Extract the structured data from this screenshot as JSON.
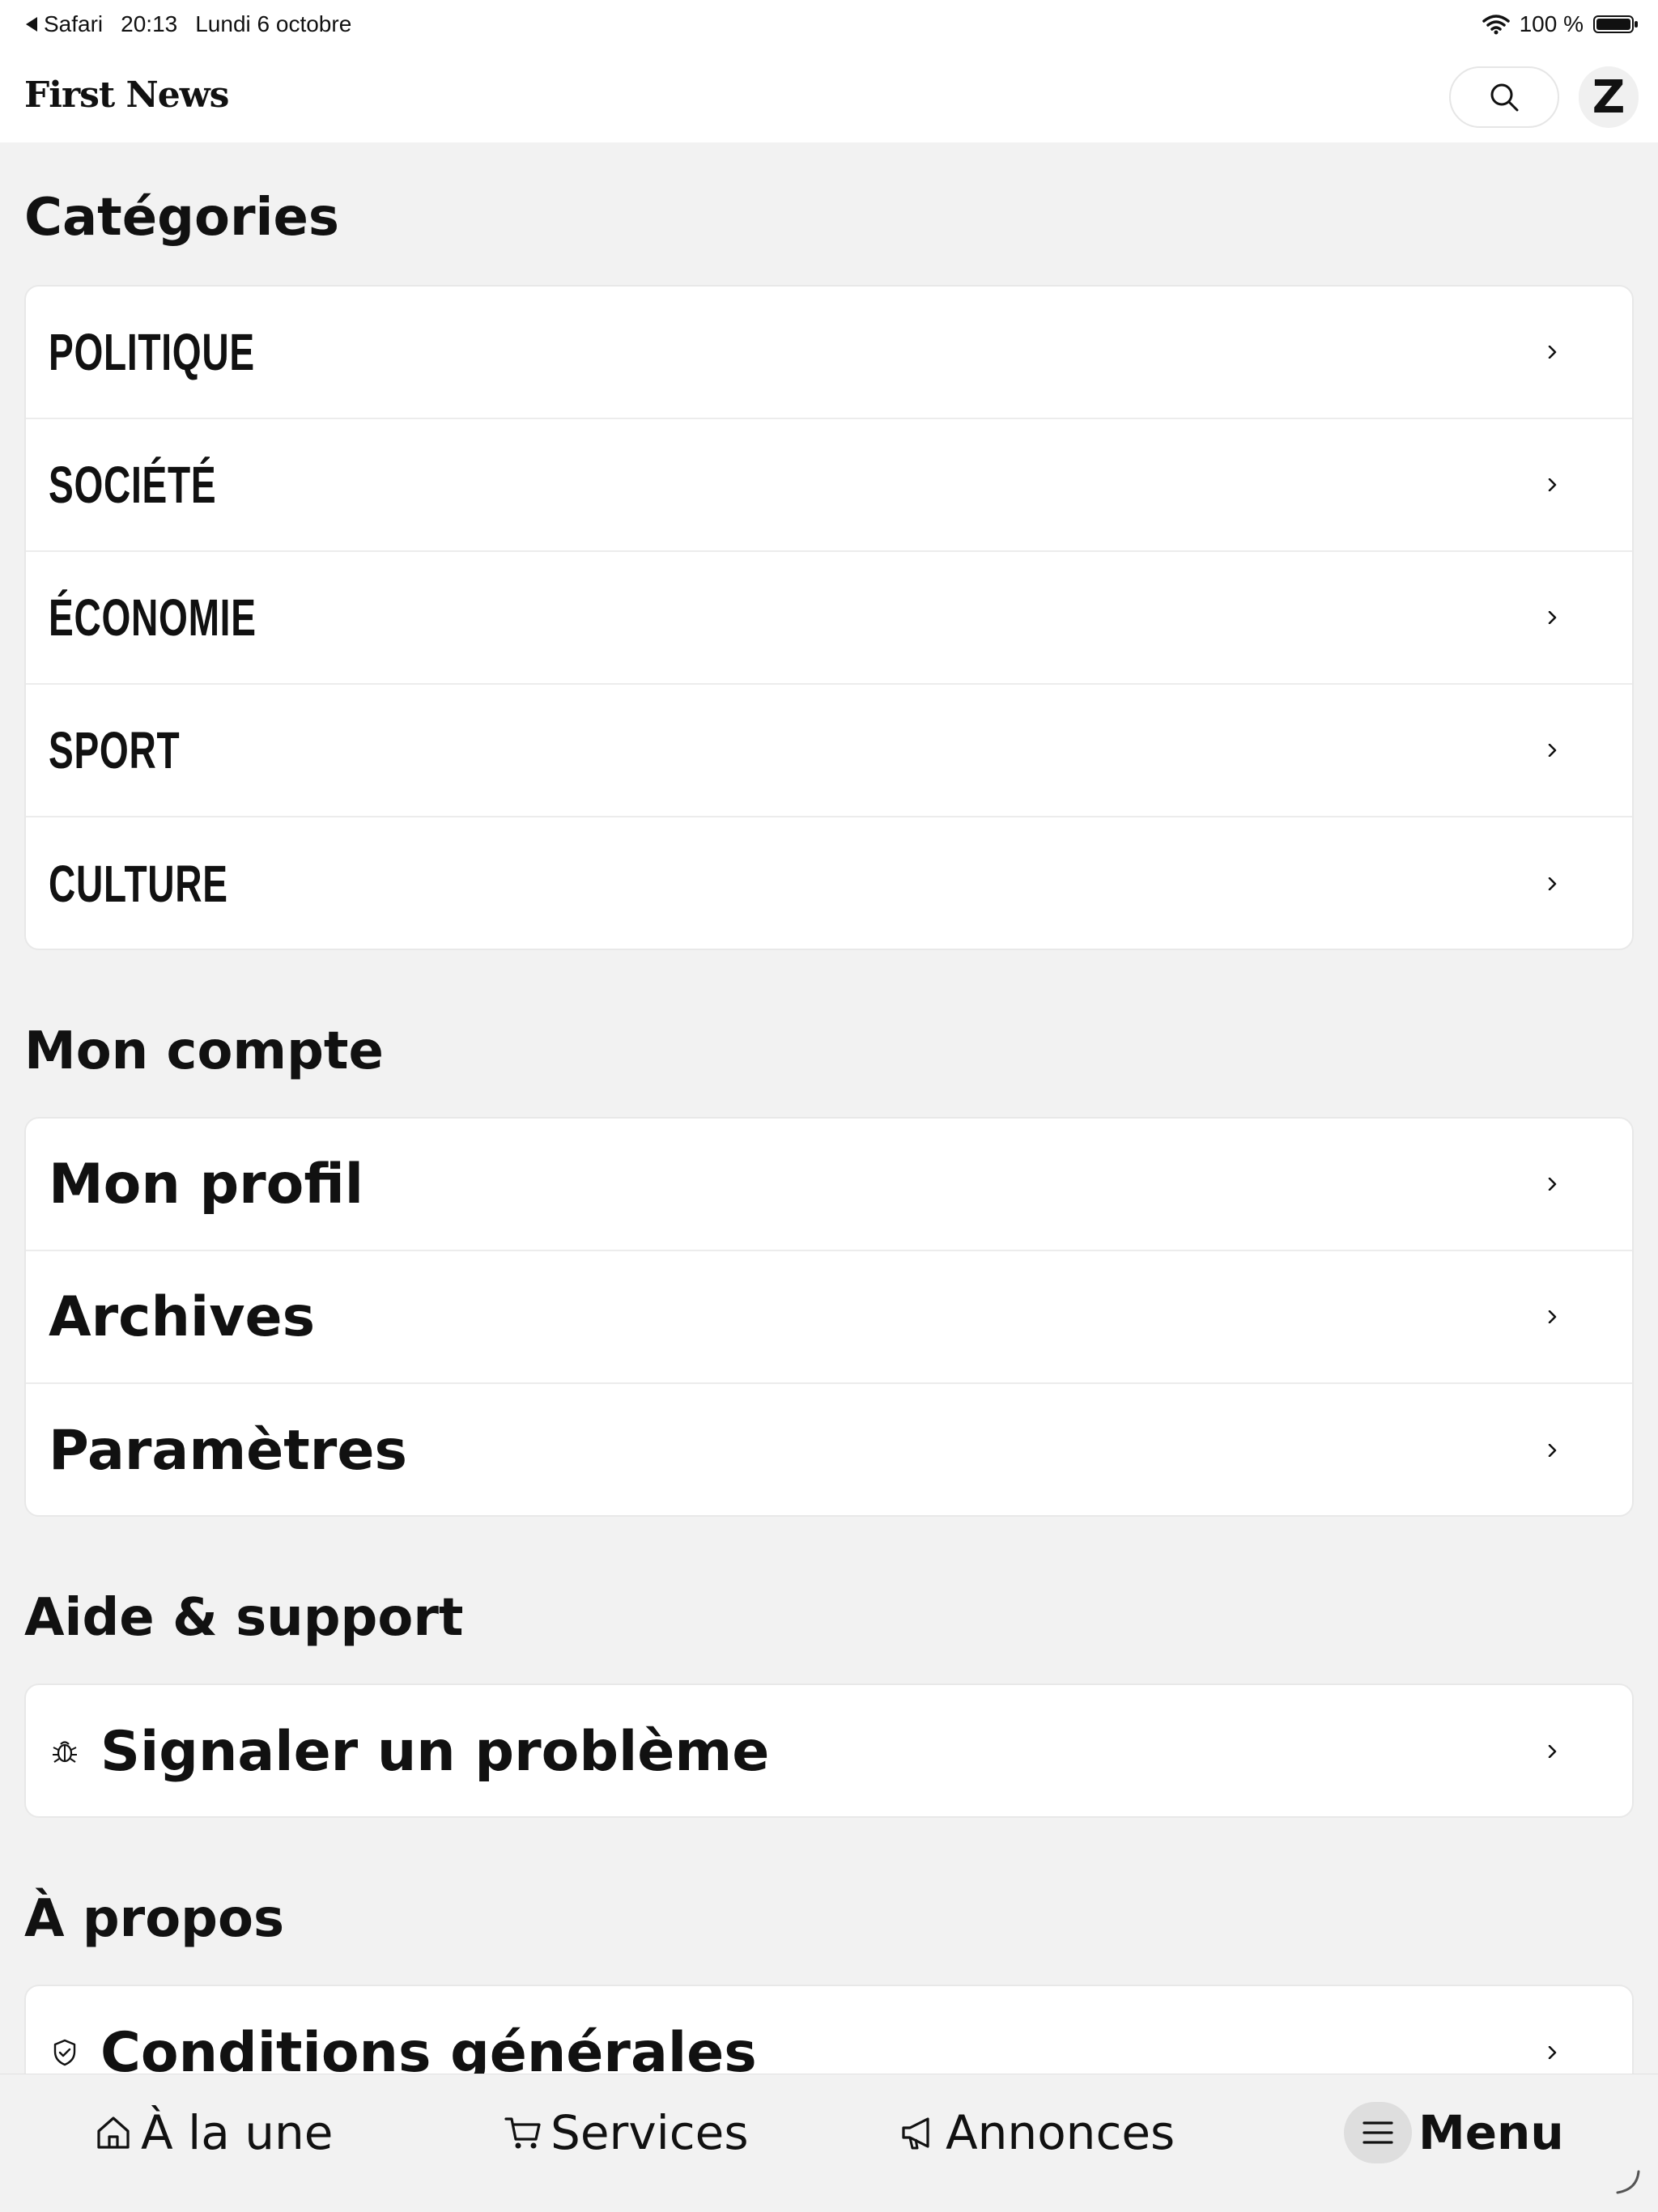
{
  "status_bar": {
    "back_app": "Safari",
    "time": "20:13",
    "date": "Lundi 6 octobre",
    "battery": "100 %"
  },
  "header": {
    "logo": "First News",
    "avatar_letter": "Z"
  },
  "sections": {
    "categories": {
      "title": "Catégories",
      "items": [
        "POLITIQUE",
        "SOCIÉTÉ",
        "ÉCONOMIE",
        "SPORT",
        "CULTURE"
      ]
    },
    "account": {
      "title": "Mon compte",
      "items": [
        "Mon profil",
        "Archives",
        "Paramètres"
      ]
    },
    "help": {
      "title": "Aide & support",
      "items": [
        "Signaler un problème"
      ]
    },
    "about": {
      "title": "À propos",
      "items": [
        "Conditions générales"
      ]
    }
  },
  "bottom_nav": {
    "home": "À la une",
    "services": "Services",
    "ads": "Annonces",
    "menu": "Menu"
  },
  "icons": {
    "search": "search-icon",
    "chevron": "chevron-right-icon",
    "bug": "bug-icon",
    "shield": "shield-icon",
    "home": "home-icon",
    "cart": "cart-icon",
    "megaphone": "megaphone-icon",
    "menu": "hamburger-icon"
  }
}
